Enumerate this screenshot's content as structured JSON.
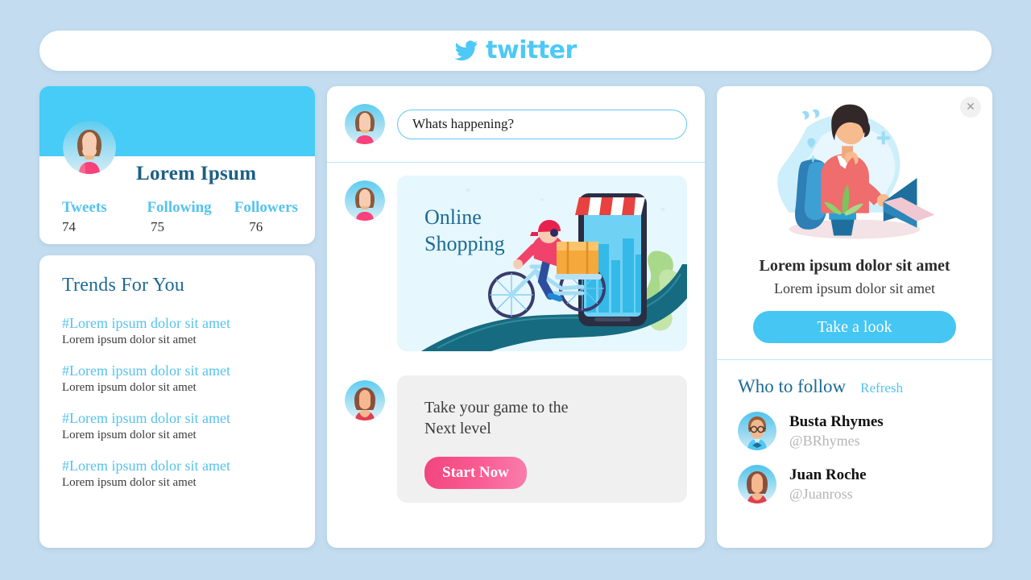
{
  "header": {
    "brand": "twitter",
    "bird_icon": "twitter-bird-icon"
  },
  "profile": {
    "name": "Lorem  Ipsum",
    "avatar_icon": "female-avatar",
    "stats": [
      {
        "label": "Tweets",
        "value": "74"
      },
      {
        "label": "Following",
        "value": "75"
      },
      {
        "label": "Followers",
        "value": "76"
      }
    ]
  },
  "trends": {
    "title": "Trends For You",
    "items": [
      {
        "tag": "#Lorem ipsum dolor sit amet",
        "sub": "Lorem ipsum  dolor  sit amet"
      },
      {
        "tag": "#Lorem ipsum dolor sit amet",
        "sub": "Lorem ipsum  dolor  sit amet"
      },
      {
        "tag": "#Lorem ipsum dolor sit amet",
        "sub": "Lorem ipsum  dolor  sit amet"
      },
      {
        "tag": "#Lorem ipsum dolor sit amet",
        "sub": "Lorem ipsum  dolor  sit amet"
      }
    ]
  },
  "compose": {
    "value": "Whats happening?",
    "placeholder": "Whats happening?",
    "avatar_icon": "female-avatar"
  },
  "feed": {
    "promo": {
      "title_line1": "Online",
      "title_line2": "Shopping",
      "illustration": "delivery-cyclist-smartphone-illustration",
      "avatar_icon": "female-avatar"
    },
    "game": {
      "title_line1": "Take your game to the",
      "title_line2": "Next level",
      "button": "Start Now",
      "avatar_icon": "female-avatar"
    }
  },
  "ad": {
    "close_icon": "close-icon",
    "illustration": "person-working-on-laptop-illustration",
    "title": "Lorem ipsum dolor sit amet",
    "subtitle": "Lorem ipsum dolor sit amet",
    "button": "Take a look"
  },
  "who_to_follow": {
    "title": "Who to follow",
    "refresh": "Refresh",
    "people": [
      {
        "name": "Busta Rhymes",
        "handle": "@BRhymes",
        "avatar_icon": "male-avatar-glasses"
      },
      {
        "name": "Juan Roche",
        "handle": "@Juanross",
        "avatar_icon": "female-avatar-bob"
      }
    ]
  },
  "colors": {
    "page_bg": "#c3dcef",
    "brand_blue": "#4ec9f5",
    "banner_blue": "#46ccf7",
    "deep_teal": "#1d6a94",
    "pink": "#f2447f",
    "promo_bg": "#e6f7fd"
  }
}
